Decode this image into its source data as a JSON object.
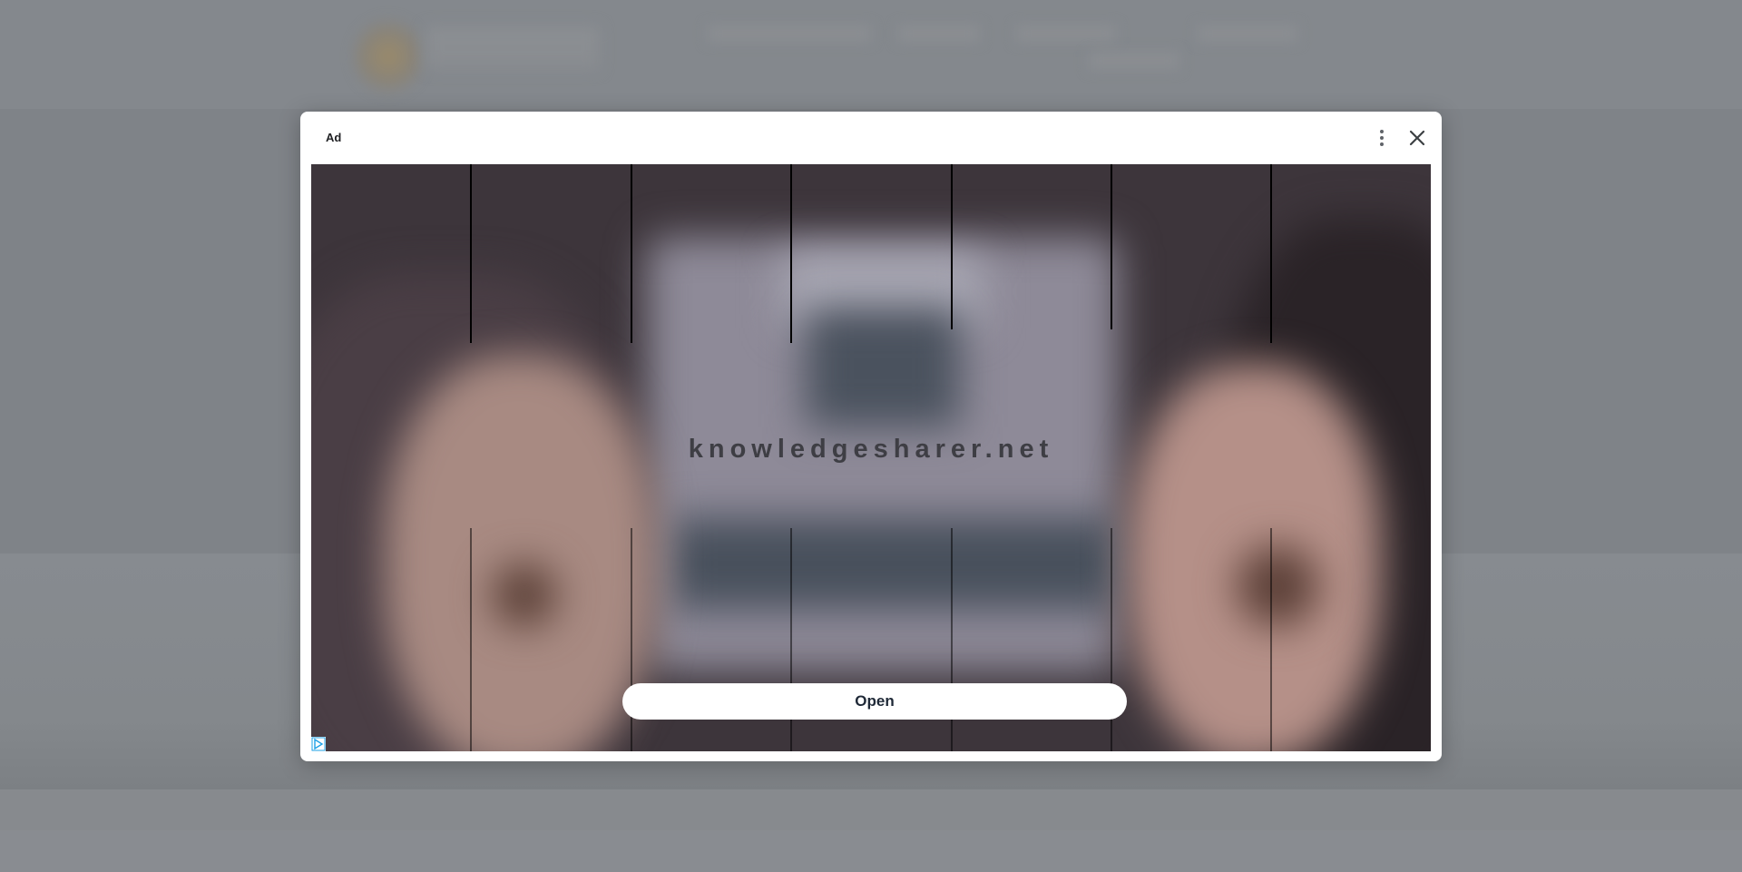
{
  "ad": {
    "label": "Ad",
    "brand_text": "knowledgesharer.net",
    "cta_label": "Open",
    "icons": {
      "more": "more-vertical-icon",
      "close": "close-icon",
      "adchoices": "adchoices-icon"
    }
  },
  "colors": {
    "overlay": "#7f8388",
    "modal_bg": "#ffffff",
    "cta_text": "#1f2937",
    "brand_text": "#3e3e44",
    "adchoices": "#1ea1e6"
  }
}
